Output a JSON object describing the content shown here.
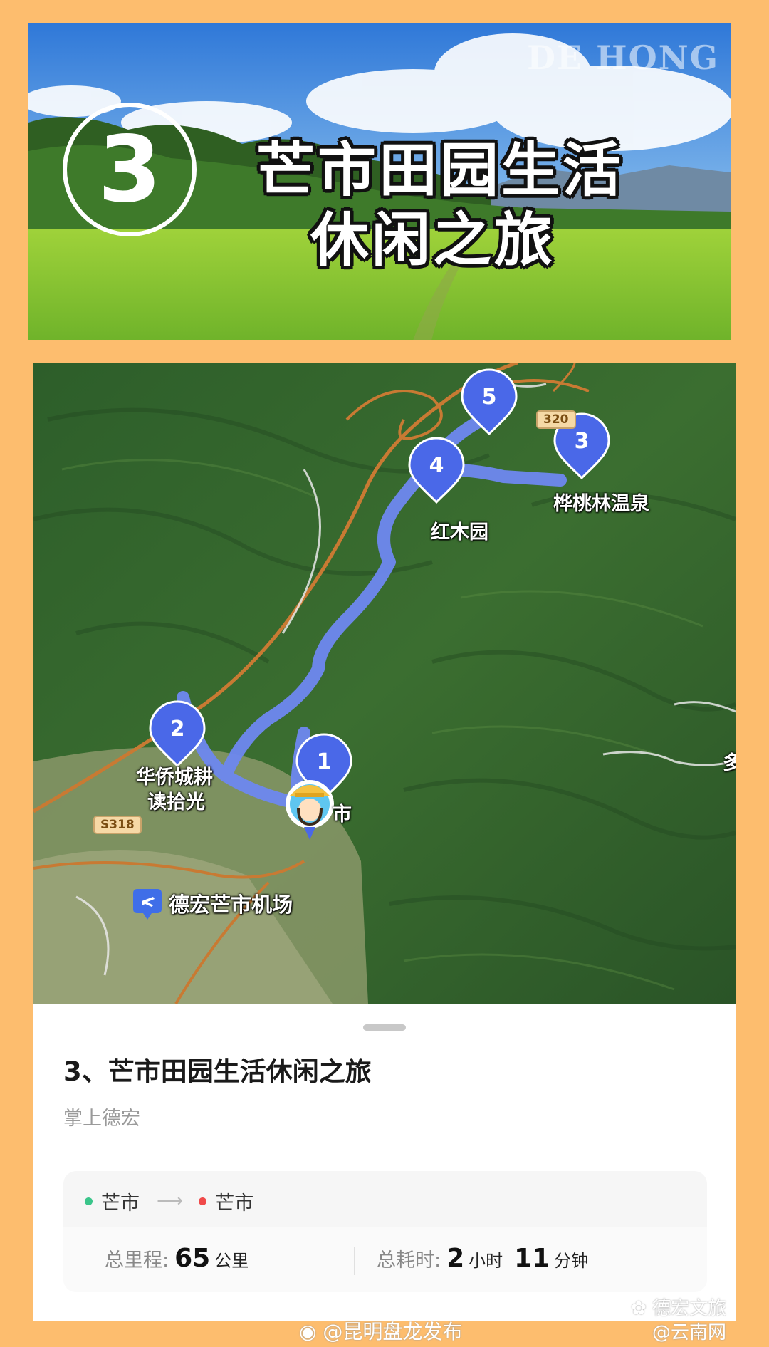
{
  "banner": {
    "watermark": "DE HONG",
    "number": "3",
    "title_line1": "芒市田园生活",
    "title_line2": "休闲之旅"
  },
  "map": {
    "pins": [
      {
        "number": "5",
        "label": ""
      },
      {
        "number": "3",
        "label": "桦桃林温泉"
      },
      {
        "number": "4",
        "label": "红木园"
      },
      {
        "number": "2",
        "label": "华侨城耕读拾光"
      },
      {
        "number": "1",
        "label": "市"
      }
    ],
    "pin2_label_line1": "华侨城耕",
    "pin2_label_line2": "读拾光",
    "road_badges": [
      "320",
      "S318"
    ],
    "airport_label": "德宏芒市机场",
    "edge_label": "多",
    "route_color": "#6e88f0",
    "pin_color": "#4a68e8"
  },
  "sheet": {
    "route_title": "3、芒市田园生活休闲之旅",
    "source": "掌上德宏",
    "start": "芒市",
    "end": "芒市",
    "start_color": "#3ac58a",
    "end_color": "#f04a4a",
    "distance_label": "总里程:",
    "distance_value": "65",
    "distance_unit": "公里",
    "duration_label": "总耗时:",
    "hours_value": "2",
    "hours_unit": "小时",
    "minutes_value": "11",
    "minutes_unit": "分钟"
  },
  "credits": {
    "weibo": "@昆明盘龙发布",
    "wechat": "德宏文旅",
    "yunnan": "@云南网"
  }
}
